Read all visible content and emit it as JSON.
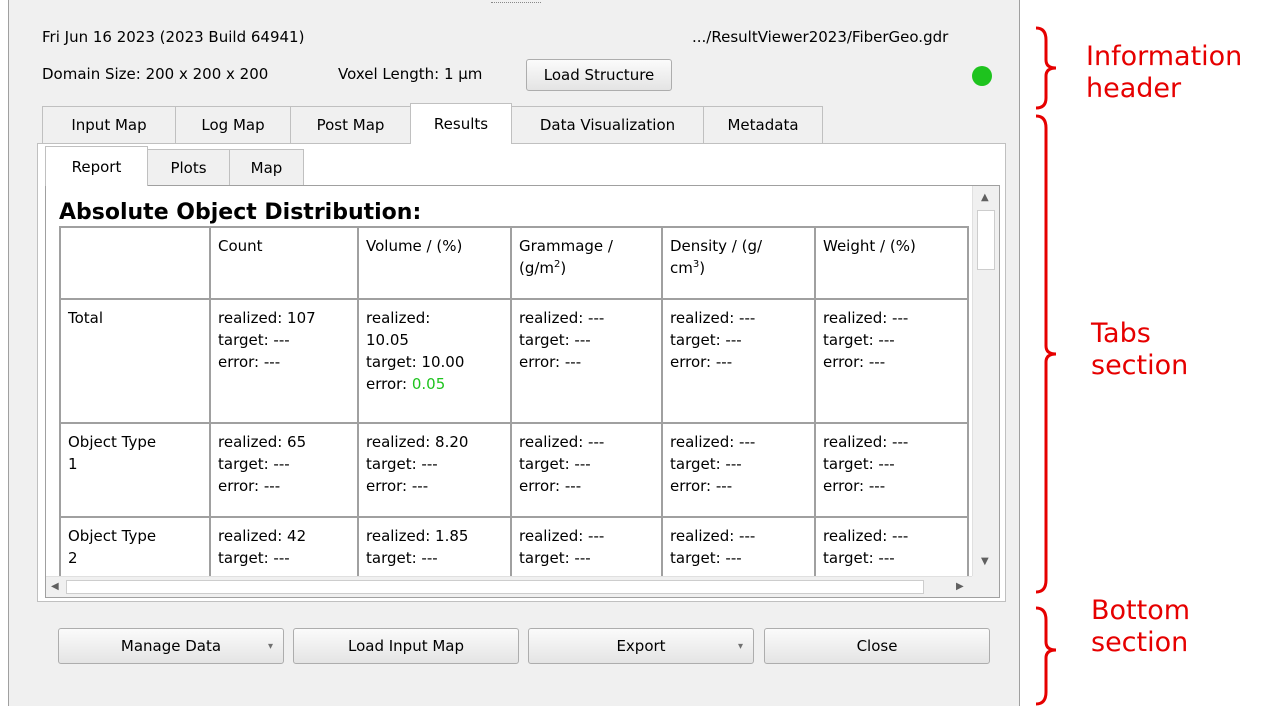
{
  "header": {
    "date_build": "Fri Jun 16 2023 (2023 Build 64941)",
    "file_path": ".../ResultViewer2023/FiberGeo.gdr",
    "domain_size": "Domain Size: 200 x 200 x 200",
    "voxel_length": "Voxel Length: 1 µm",
    "load_structure_label": "Load Structure",
    "status_color": "#1ec31e"
  },
  "tabs": [
    "Input Map",
    "Log Map",
    "Post Map",
    "Results",
    "Data Visualization",
    "Metadata"
  ],
  "active_tab": "Results",
  "subtabs": [
    "Report",
    "Plots",
    "Map"
  ],
  "active_subtab": "Report",
  "report": {
    "title": "Absolute Object Distribution:",
    "columns": {
      "blank": "",
      "count": "Count",
      "volume": "Volume / (%)",
      "grammage_a": "Grammage /",
      "grammage_b": "(g/m",
      "grammage_sup": "2",
      "grammage_c": ")",
      "density_a": "Density / (g/",
      "density_b": "cm",
      "density_sup": "3",
      "density_c": ")",
      "weight": "Weight / (%)"
    },
    "rows": [
      {
        "label": "Total",
        "count": [
          "realized: 107",
          "target: ---",
          "error: ---"
        ],
        "volume": [
          "realized:",
          "10.05",
          "target: 10.00",
          "error: "
        ],
        "volume_error_value": "0.05",
        "grammage": [
          "realized: ---",
          "target: ---",
          "error: ---"
        ],
        "density": [
          "realized: ---",
          "target: ---",
          "error: ---"
        ],
        "weight": [
          "realized: ---",
          "target: ---",
          "error: ---"
        ]
      },
      {
        "label_a": "Object Type",
        "label_b": "1",
        "count": [
          "realized: 65",
          "target: ---",
          "error: ---"
        ],
        "volume": [
          "realized: 8.20",
          "target: ---",
          "error: ---"
        ],
        "grammage": [
          "realized: ---",
          "target: ---",
          "error: ---"
        ],
        "density": [
          "realized: ---",
          "target: ---",
          "error: ---"
        ],
        "weight": [
          "realized: ---",
          "target: ---",
          "error: ---"
        ]
      },
      {
        "label_a": "Object Type",
        "label_b": "2",
        "count": [
          "realized: 42",
          "target: ---"
        ],
        "volume": [
          "realized: 1.85",
          "target: ---"
        ],
        "grammage": [
          "realized: ---",
          "target: ---"
        ],
        "density": [
          "realized: ---",
          "target: ---"
        ],
        "weight": [
          "realized: ---",
          "target: ---"
        ]
      }
    ]
  },
  "buttons": {
    "manage_data": "Manage Data",
    "load_input_map": "Load Input Map",
    "export": "Export",
    "close": "Close"
  },
  "annotations": {
    "info_1": "Information",
    "info_2": "header",
    "tabs_1": "Tabs",
    "tabs_2": "section",
    "bottom_1": "Bottom",
    "bottom_2": "section",
    "color": "#e60000"
  }
}
